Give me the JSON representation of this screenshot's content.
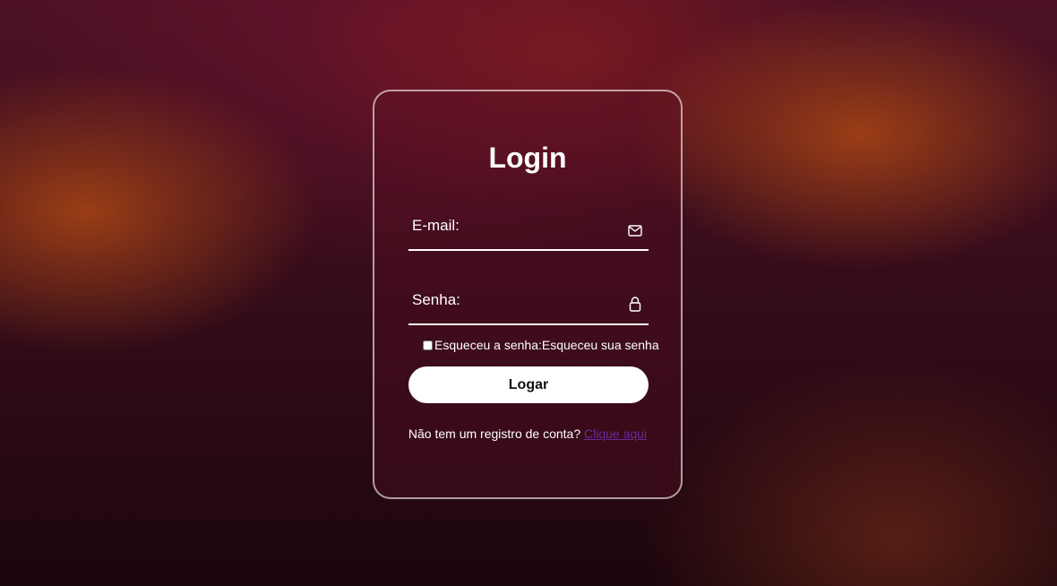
{
  "login": {
    "title": "Login",
    "email_label": "E-mail:",
    "email_icon": "envelope-icon",
    "password_label": "Senha:",
    "password_icon": "lock-icon",
    "remember_label": "Esqueceu a senha:Esqueceu sua senha",
    "submit_label": "Logar",
    "register_text": "Não tem um registro de conta?",
    "register_link": "Clique aqui"
  },
  "colors": {
    "card_border": "#ffffff",
    "button_bg": "#ffffff",
    "link": "#6a2a9a"
  }
}
